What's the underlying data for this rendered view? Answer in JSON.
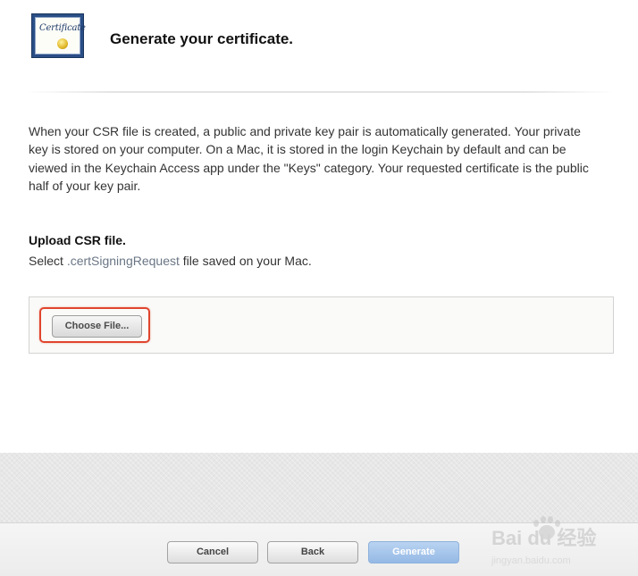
{
  "header": {
    "icon_label": "Certificate",
    "icon": "certificate-icon",
    "title": "Generate your certificate."
  },
  "content": {
    "description": "When your CSR file is created, a public and private key pair is automatically generated. Your private key is stored on your computer. On a Mac, it is stored in the login Keychain by default and can be viewed in the Keychain Access app under the \"Keys\" category. Your requested certificate is the public half of your key pair.",
    "upload_heading": "Upload CSR file.",
    "instruction_prefix": "Select ",
    "instruction_extension": ".certSigningRequest",
    "instruction_suffix": " file saved on your Mac.",
    "choose_file_label": "Choose File..."
  },
  "footer": {
    "cancel_label": "Cancel",
    "back_label": "Back",
    "generate_label": "Generate"
  },
  "watermark": {
    "brand": "Bai du 经验",
    "url": "jingyan.baidu.com"
  },
  "colors": {
    "highlight": "#e0452e",
    "primary_button": "#a6c6ec",
    "icon_frame": "#2a4e86"
  }
}
